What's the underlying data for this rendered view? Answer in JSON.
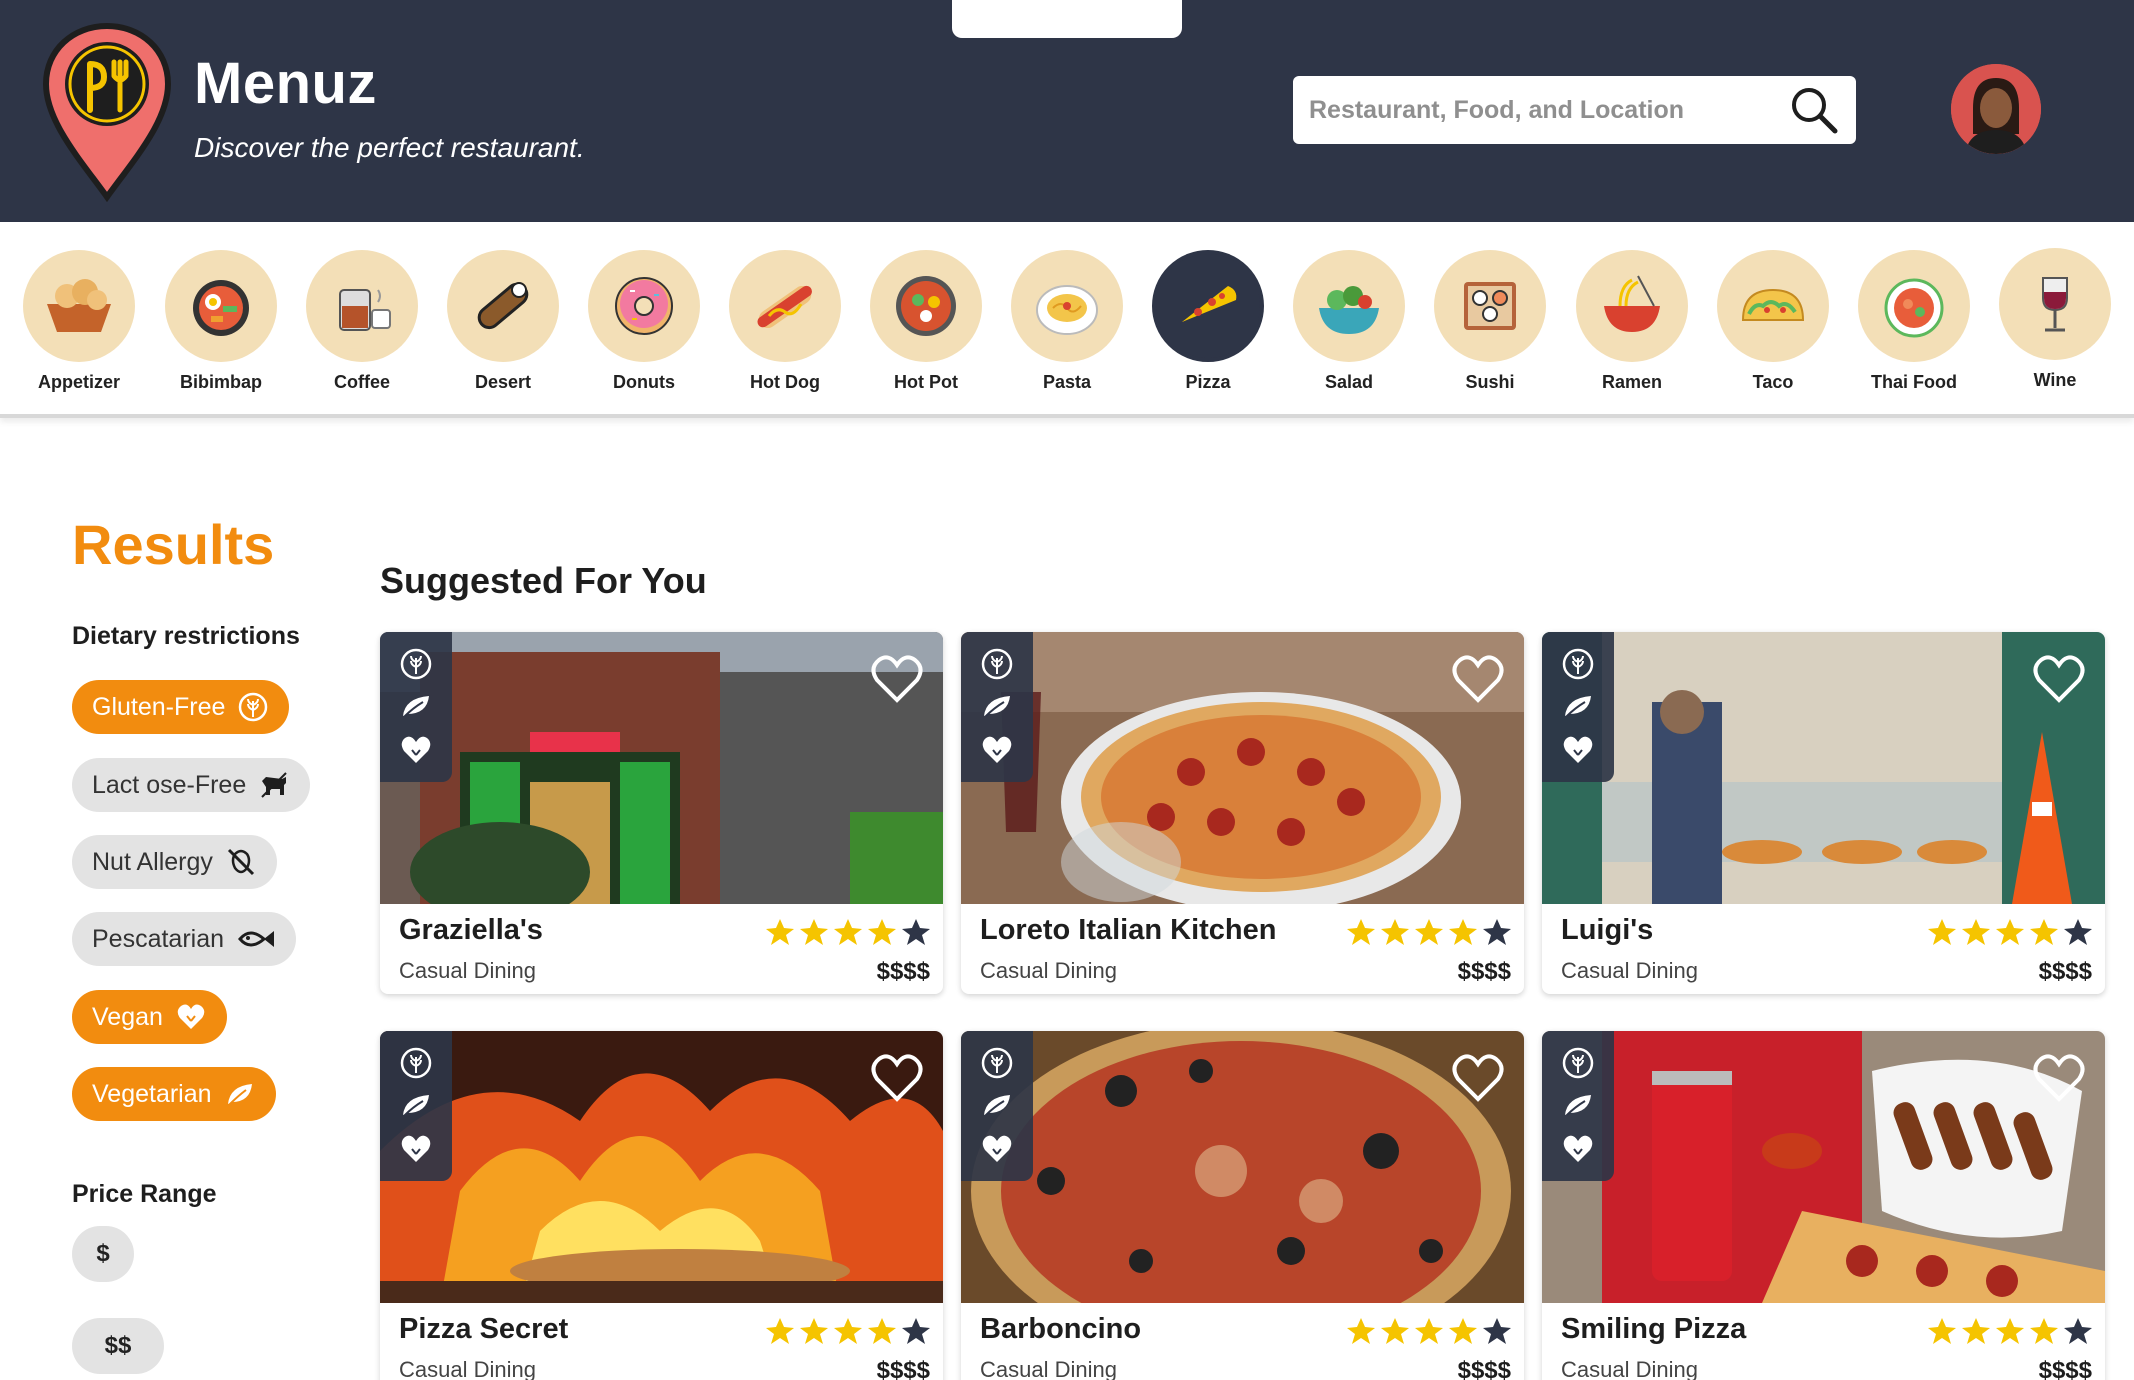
{
  "app": {
    "title": "Menuz",
    "tagline": "Discover the perfect restaurant.",
    "logo_icon": "fork-knife-pin-icon"
  },
  "search": {
    "placeholder": "Restaurant, Food, and Location",
    "value": ""
  },
  "colors": {
    "header_bg": "#2e3547",
    "accent_orange": "#f28c0f",
    "category_bg": "#f3dfb7",
    "chip_off": "#e3e3e3",
    "star_gold": "#f5c400",
    "star_dark": "#2e3547"
  },
  "categories": [
    {
      "label": "Appetizer",
      "icon": "appetizer-icon",
      "active": false
    },
    {
      "label": "Bibimbap",
      "icon": "bibimbap-icon",
      "active": false
    },
    {
      "label": "Coffee",
      "icon": "coffee-icon",
      "active": false
    },
    {
      "label": "Desert",
      "icon": "desert-icon",
      "active": false
    },
    {
      "label": "Donuts",
      "icon": "donut-icon",
      "active": false
    },
    {
      "label": "Hot Dog",
      "icon": "hot-dog-icon",
      "active": false
    },
    {
      "label": "Hot Pot",
      "icon": "hot-pot-icon",
      "active": false
    },
    {
      "label": "Pasta",
      "icon": "pasta-icon",
      "active": false
    },
    {
      "label": "Pizza",
      "icon": "pizza-icon",
      "active": true
    },
    {
      "label": "Salad",
      "icon": "salad-icon",
      "active": false
    },
    {
      "label": "Sushi",
      "icon": "sushi-icon",
      "active": false
    },
    {
      "label": "Ramen",
      "icon": "ramen-icon",
      "active": false
    },
    {
      "label": "Taco",
      "icon": "taco-icon",
      "active": false
    },
    {
      "label": "Thai Food",
      "icon": "thai-food-icon",
      "active": false
    },
    {
      "label": "Wine",
      "icon": "wine-icon",
      "active": false
    }
  ],
  "sidebar": {
    "results_title": "Results",
    "dietary_heading": "Dietary restrictions",
    "dietary": [
      {
        "label": "Gluten-Free",
        "icon": "wheat-icon",
        "selected": true
      },
      {
        "label": "Lact ose-Free",
        "icon": "cow-icon",
        "selected": false
      },
      {
        "label": "Nut Allergy",
        "icon": "no-nut-icon",
        "selected": false
      },
      {
        "label": "Pescatarian",
        "icon": "fish-icon",
        "selected": false
      },
      {
        "label": "Vegan",
        "icon": "heart-icon",
        "selected": true
      },
      {
        "label": "Vegetarian",
        "icon": "leaf-icon",
        "selected": true
      }
    ],
    "price_heading": "Price Range",
    "prices": [
      "$",
      "$$"
    ]
  },
  "main": {
    "section_title": "Suggested For You",
    "cards": [
      {
        "name": "Graziella's",
        "type": "Casual Dining",
        "price": "$$$$",
        "rating": 4,
        "max_rating": 5,
        "photo": "storefront-photo"
      },
      {
        "name": "Loreto Italian Kitchen",
        "type": "Casual Dining",
        "price": "$$$$",
        "rating": 4,
        "max_rating": 5,
        "photo": "pepperoni-pizza-photo"
      },
      {
        "name": "Luigi's",
        "type": "Casual Dining",
        "price": "$$$$",
        "rating": 4,
        "max_rating": 5,
        "photo": "pizza-counter-photo"
      },
      {
        "name": "Pizza Secret",
        "type": "Casual Dining",
        "price": "$$$$",
        "rating": 4,
        "max_rating": 5,
        "photo": "wood-fired-oven-photo"
      },
      {
        "name": "Barboncino",
        "type": "Casual Dining",
        "price": "$$$$",
        "rating": 4,
        "max_rating": 5,
        "photo": "charred-pizza-photo"
      },
      {
        "name": "Smiling Pizza",
        "type": "Casual Dining",
        "price": "$$$$",
        "rating": 4,
        "max_rating": 5,
        "photo": "pizza-slice-and-soda-photo"
      }
    ]
  }
}
